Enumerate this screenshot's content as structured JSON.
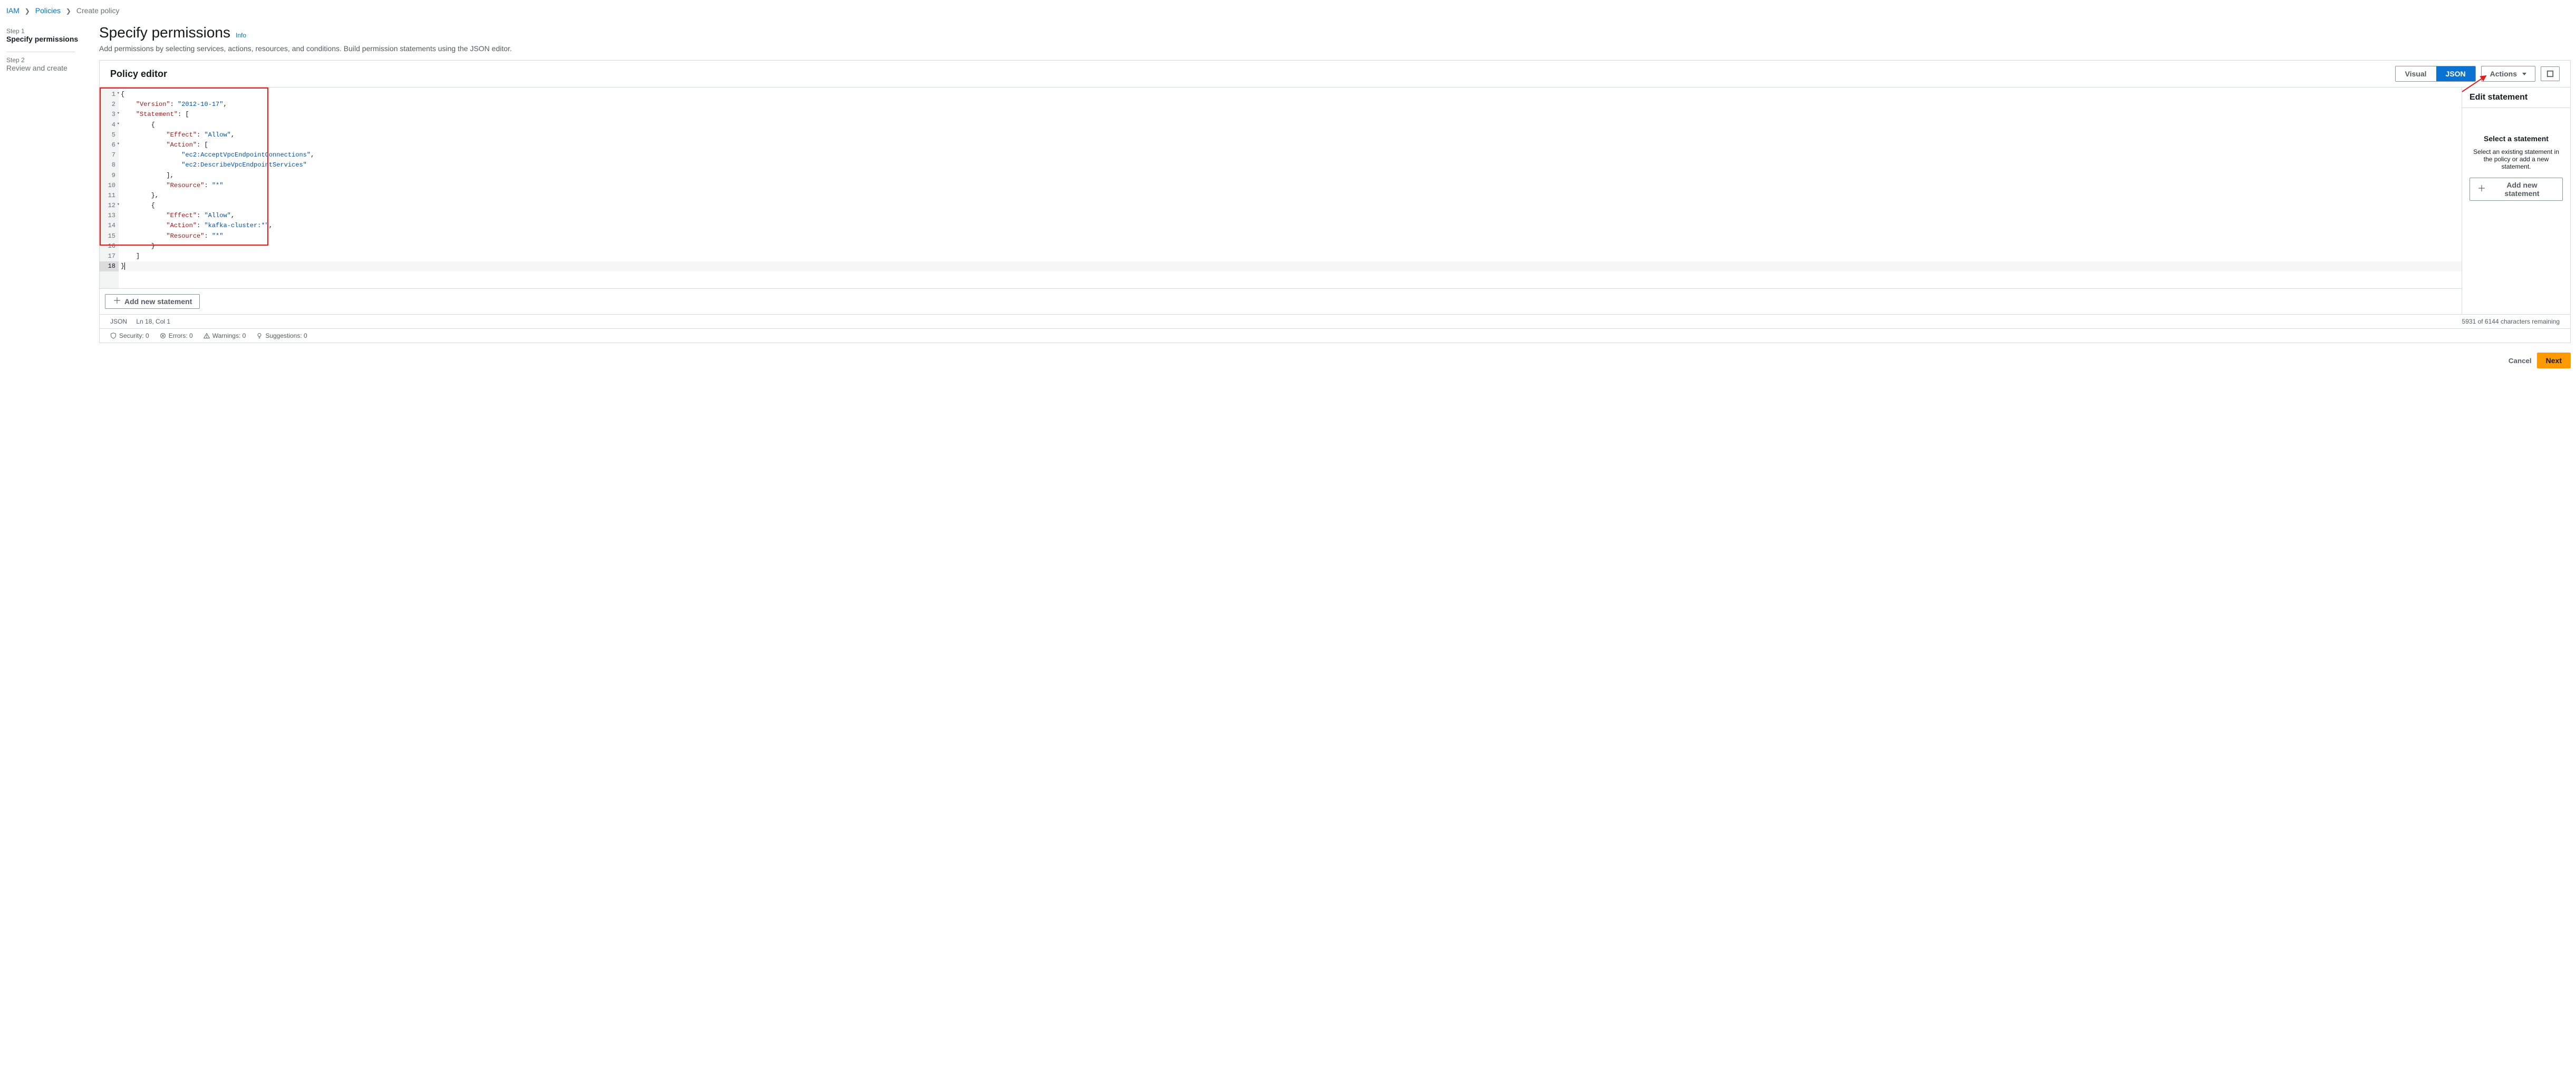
{
  "breadcrumbs": {
    "items": [
      {
        "label": "IAM",
        "href": true
      },
      {
        "label": "Policies",
        "href": true
      },
      {
        "label": "Create policy",
        "href": false
      }
    ]
  },
  "sidebar": {
    "steps": [
      {
        "label": "Step 1",
        "name": "Specify permissions",
        "active": true
      },
      {
        "label": "Step 2",
        "name": "Review and create",
        "active": false
      }
    ]
  },
  "header": {
    "title": "Specify permissions",
    "info": "Info",
    "desc": "Add permissions by selecting services, actions, resources, and conditions. Build permission statements using the JSON editor."
  },
  "editor": {
    "title": "Policy editor",
    "toggle": {
      "visual": "Visual",
      "json": "JSON"
    },
    "actions_label": "Actions",
    "lines_meta": [
      {
        "n": 1,
        "fold": true
      },
      {
        "n": 2,
        "fold": false
      },
      {
        "n": 3,
        "fold": true
      },
      {
        "n": 4,
        "fold": true
      },
      {
        "n": 5,
        "fold": false
      },
      {
        "n": 6,
        "fold": true
      },
      {
        "n": 7,
        "fold": false
      },
      {
        "n": 8,
        "fold": false
      },
      {
        "n": 9,
        "fold": false
      },
      {
        "n": 10,
        "fold": false
      },
      {
        "n": 11,
        "fold": false
      },
      {
        "n": 12,
        "fold": true
      },
      {
        "n": 13,
        "fold": false
      },
      {
        "n": 14,
        "fold": false
      },
      {
        "n": 15,
        "fold": false
      },
      {
        "n": 16,
        "fold": false
      },
      {
        "n": 17,
        "fold": false
      },
      {
        "n": 18,
        "fold": false,
        "current": true
      }
    ],
    "policy_json": {
      "Version": "2012-10-17",
      "Statement": [
        {
          "Effect": "Allow",
          "Action": [
            "ec2:AcceptVpcEndpointConnections",
            "ec2:DescribeVpcEndpointServices"
          ],
          "Resource": "*"
        },
        {
          "Effect": "Allow",
          "Action": "kafka-cluster:*",
          "Resource": "*"
        }
      ]
    },
    "add_stmt": "Add new statement"
  },
  "side_panel": {
    "title": "Edit statement",
    "heading": "Select a statement",
    "desc": "Select an existing statement in the policy or add a new statement.",
    "add_btn": "Add new statement"
  },
  "status": {
    "mode": "JSON",
    "pos": "Ln 18, Col 1",
    "chars": "5931 of 6144 characters remaining",
    "security": "Security: 0",
    "errors": "Errors: 0",
    "warnings": "Warnings: 0",
    "suggestions": "Suggestions: 0"
  },
  "footer": {
    "cancel": "Cancel",
    "next": "Next"
  }
}
